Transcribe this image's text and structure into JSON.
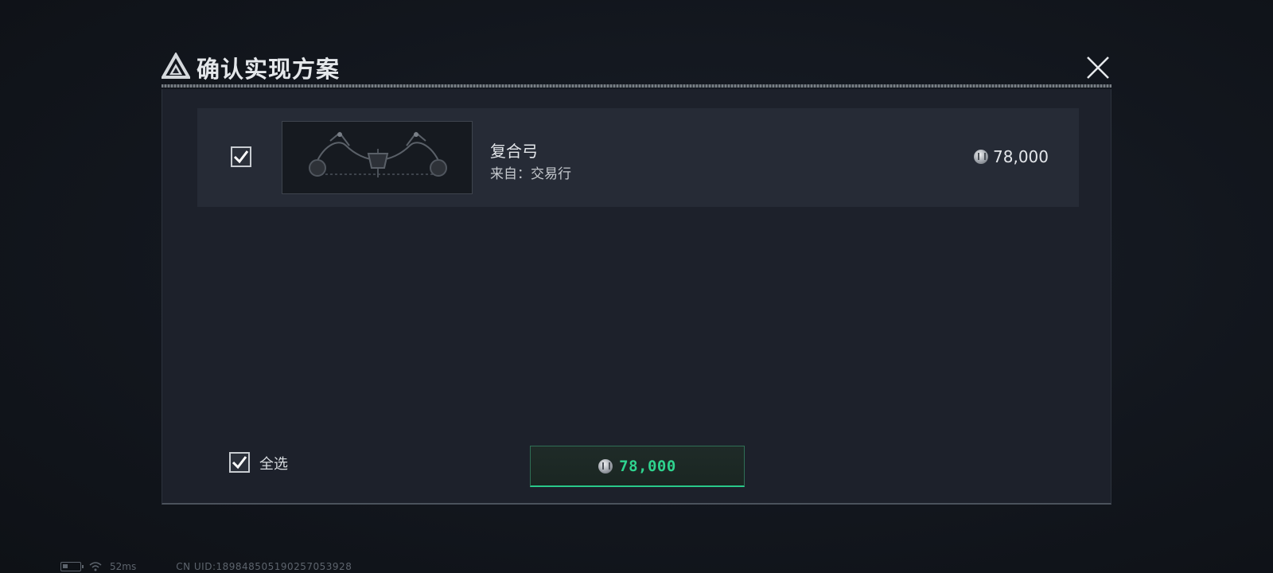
{
  "dialog": {
    "title": "确认实现方案"
  },
  "items": [
    {
      "name": "复合弓",
      "source": "来自：交易行",
      "price": "78,000",
      "checked": true,
      "image_icon": "compound-bow-icon"
    }
  ],
  "footer": {
    "select_all_label": "全选",
    "select_all_checked": true,
    "total": "78,000"
  },
  "status_bar": {
    "ping": "52ms",
    "uid": "CN UID:18984850519025705392​8"
  },
  "colors": {
    "accent_green": "#2fd48f",
    "panel_bg": "#1d212b",
    "row_bg": "#262b36"
  },
  "icons": [
    "triangle-logo-icon",
    "close-icon",
    "check-icon",
    "coin-icon",
    "battery-icon",
    "wifi-icon"
  ]
}
